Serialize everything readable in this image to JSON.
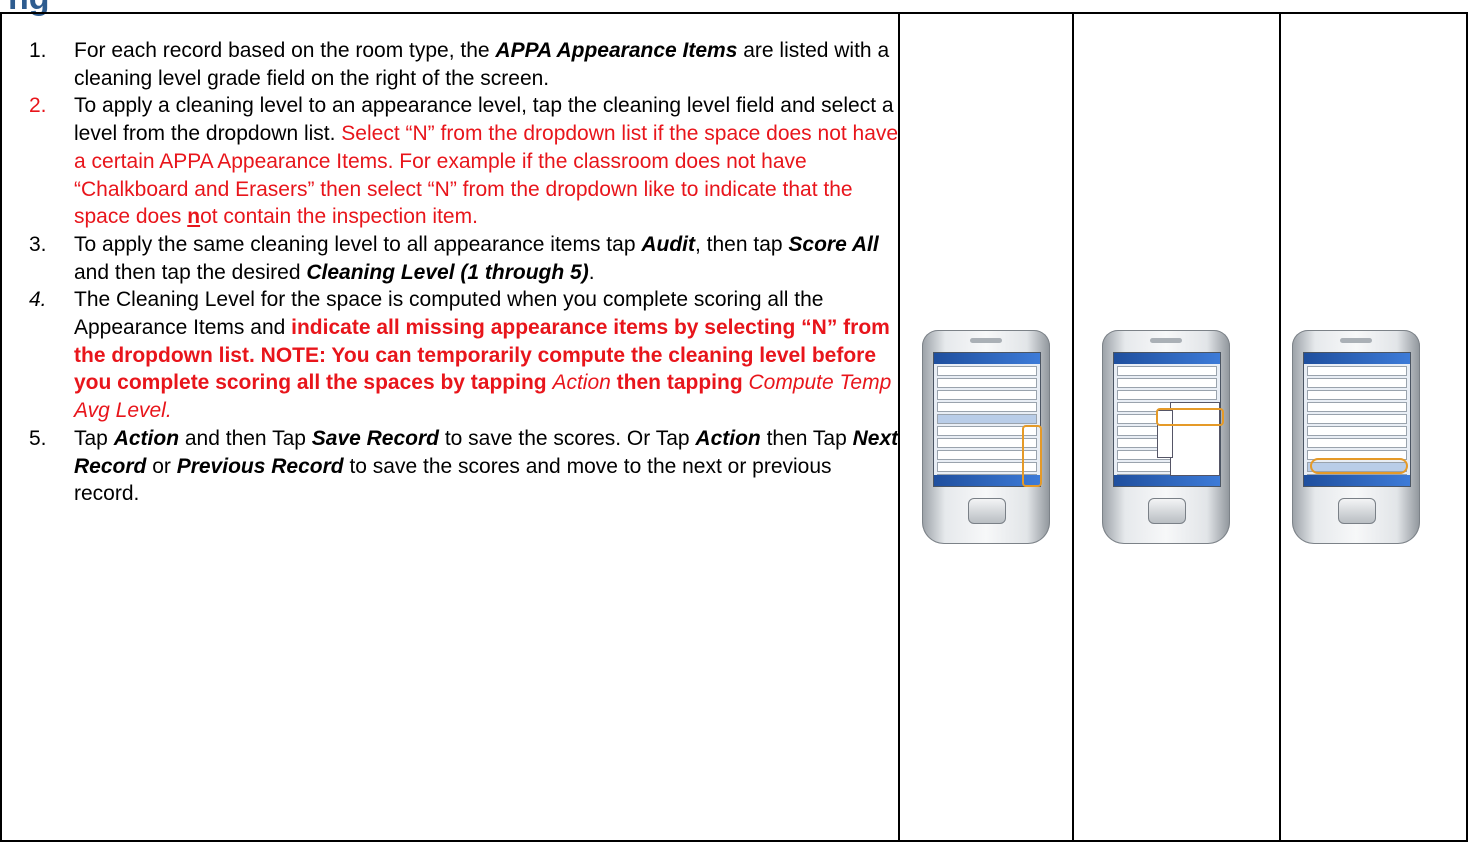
{
  "heading_fragment": "ng",
  "steps": [
    {
      "number": "1.",
      "text": [
        "For each record based on the room type, the ",
        "APPA Appearance Items",
        " are listed with a cleaning level grade field on the right of the screen."
      ]
    },
    {
      "number": "2.",
      "text": [
        "To apply a cleaning level to an appearance level, tap the cleaning level field and select a level from the dropdown list. ",
        "Select “N” from the dropdown list if the space does not have a certain APPA Appearance Items.  For example if the classroom does not have “Chalkboard and Erasers” then select “N” from the dropdown like to indicate that the space does ",
        "n",
        "ot contain the inspection item."
      ]
    },
    {
      "number": "3.",
      "text": [
        "To apply the same cleaning level to all appearance items tap ",
        "Audit",
        ", then tap ",
        "Score All",
        " and then tap the desired ",
        "Cleaning Level (1 through 5)",
        "."
      ]
    },
    {
      "number": "4.",
      "text": [
        "The Cleaning Level for the space is computed when you complete scoring all the Appearance Items and ",
        "indicate all missing appearance items by selecting “N” from the dropdown list.  NOTE: You can temporarily compute the cleaning level before you complete scoring all the spaces by tapping ",
        "Action",
        " then tapping ",
        "Compute Temp Avg Level."
      ]
    },
    {
      "number": "5.",
      "text": [
        "Tap ",
        "Action",
        " and then Tap ",
        "Save Record",
        " to save the scores.  Or Tap ",
        "Action",
        " then Tap ",
        "Next Record",
        " or ",
        "Previous Record",
        " to save the scores and move to the next or previous record."
      ]
    }
  ],
  "images": [
    {
      "name": "screenshot-1",
      "depicts": "handheld device showing cleaning level grade fields"
    },
    {
      "name": "screenshot-2",
      "depicts": "handheld device showing Audit menu with Score All"
    },
    {
      "name": "screenshot-3",
      "depicts": "handheld device showing computed space cleaning level"
    }
  ],
  "colors": {
    "heading": "#2e5c8f",
    "emphasis_red": "#e8151b",
    "highlight": "#e59a28"
  }
}
